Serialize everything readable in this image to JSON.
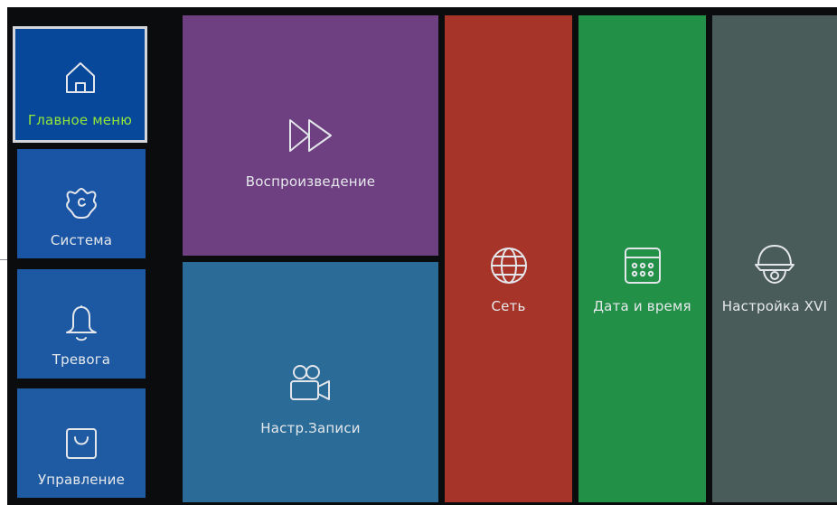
{
  "sidebar": {
    "items": [
      {
        "label": "Главное меню",
        "icon": "home-icon",
        "active": true
      },
      {
        "label": "Система",
        "icon": "gear-icon"
      },
      {
        "label": "Тревога",
        "icon": "bell-icon"
      },
      {
        "label": "Управление",
        "icon": "bag-icon"
      }
    ]
  },
  "tiles": [
    {
      "label": "Воспроизведение",
      "icon": "fast-forward-icon",
      "color": "#6e3f81"
    },
    {
      "label": "Настр.Записи",
      "icon": "video-camera-icon",
      "color": "#2a6b98"
    },
    {
      "label": "Сеть",
      "icon": "globe-icon",
      "color": "#a73428"
    },
    {
      "label": "Дата и время",
      "icon": "calendar-icon",
      "color": "#239048"
    },
    {
      "label": "Настройка XVI",
      "icon": "dome-camera-icon",
      "color": "#4a5c59"
    }
  ],
  "colors": {
    "sidebar_active_bg": "#08489a",
    "sidebar_bg": "#1a54a4",
    "sidebar_bg_light": "#1f5ba3",
    "active_label": "#93e63a",
    "background": "#0a0c0e"
  }
}
